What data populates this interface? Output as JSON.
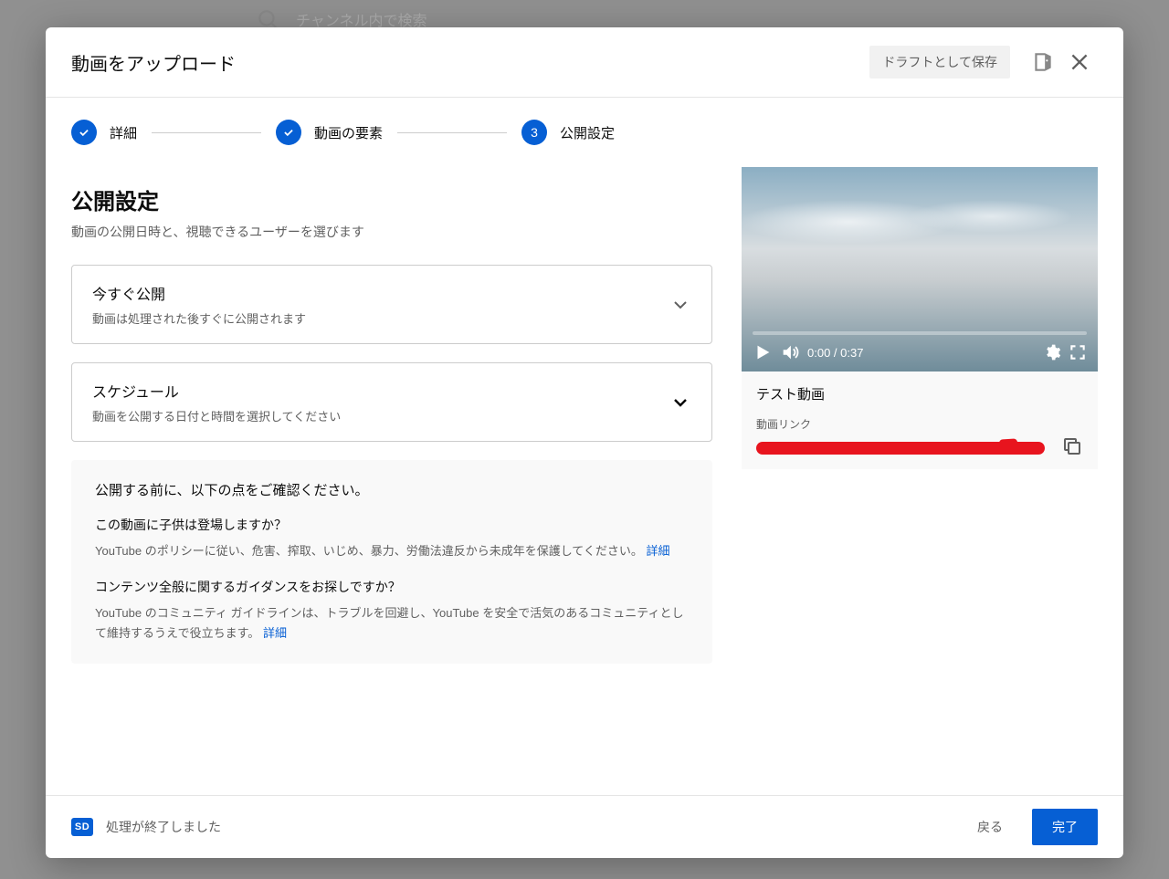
{
  "bg": {
    "search_placeholder": "チャンネル内で検索"
  },
  "modal": {
    "title": "動画をアップロード",
    "save_draft": "ドラフトとして保存"
  },
  "steps": {
    "s1": {
      "label": "詳細"
    },
    "s2": {
      "label": "動画の要素"
    },
    "s3": {
      "num": "3",
      "label": "公開設定"
    }
  },
  "section": {
    "title": "公開設定",
    "desc": "動画の公開日時と、視聴できるユーザーを選びます"
  },
  "options": {
    "now": {
      "title": "今すぐ公開",
      "desc": "動画は処理された後すぐに公開されます"
    },
    "schedule": {
      "title": "スケジュール",
      "desc": "動画を公開する日付と時間を選択してください"
    }
  },
  "info": {
    "head": "公開する前に、以下の点をご確認ください。",
    "q1": "この動画に子供は登場しますか？",
    "a1": "YouTube のポリシーに従い、危害、搾取、いじめ、暴力、労働法違反から未成年を保護してください。 ",
    "q2": "コンテンツ全般に関するガイダンスをお探しですか？",
    "a2": "YouTube のコミュニティ ガイドラインは、トラブルを回避し、YouTube を安全で活気のあるコミュニティとして維持するうえで役立ちます。 ",
    "learn_more": "詳細"
  },
  "video": {
    "time": "0:00 / 0:37",
    "title": "テスト動画",
    "link_label": "動画リンク"
  },
  "footer": {
    "sd": "SD",
    "status": "処理が終了しました",
    "back": "戻る",
    "done": "完了"
  }
}
